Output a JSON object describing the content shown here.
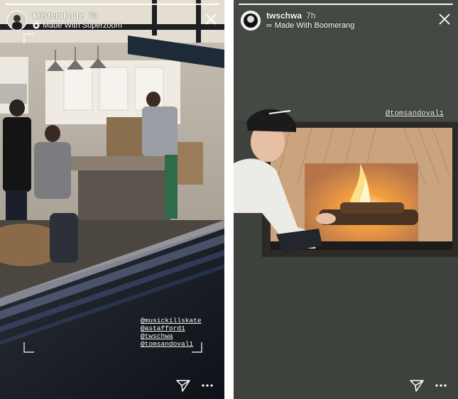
{
  "stories": [
    {
      "username": "kristendoute",
      "time": "7h",
      "subtitle_icon": "superzoom-icon",
      "subtitle": "Made With Superzoom",
      "mentions": [
        "@musickillskate",
        "@astafford1",
        "@twschwa",
        "@tomsandoval1"
      ]
    },
    {
      "username": "twschwa",
      "time": "7h",
      "subtitle_icon": "infinity-icon",
      "subtitle_symbol": "∞",
      "subtitle": "Made With Boomerang",
      "mentions": [
        "@tomsandoval1"
      ]
    }
  ],
  "colors": {
    "text": "#ffffff",
    "divider": "#ffffff"
  }
}
